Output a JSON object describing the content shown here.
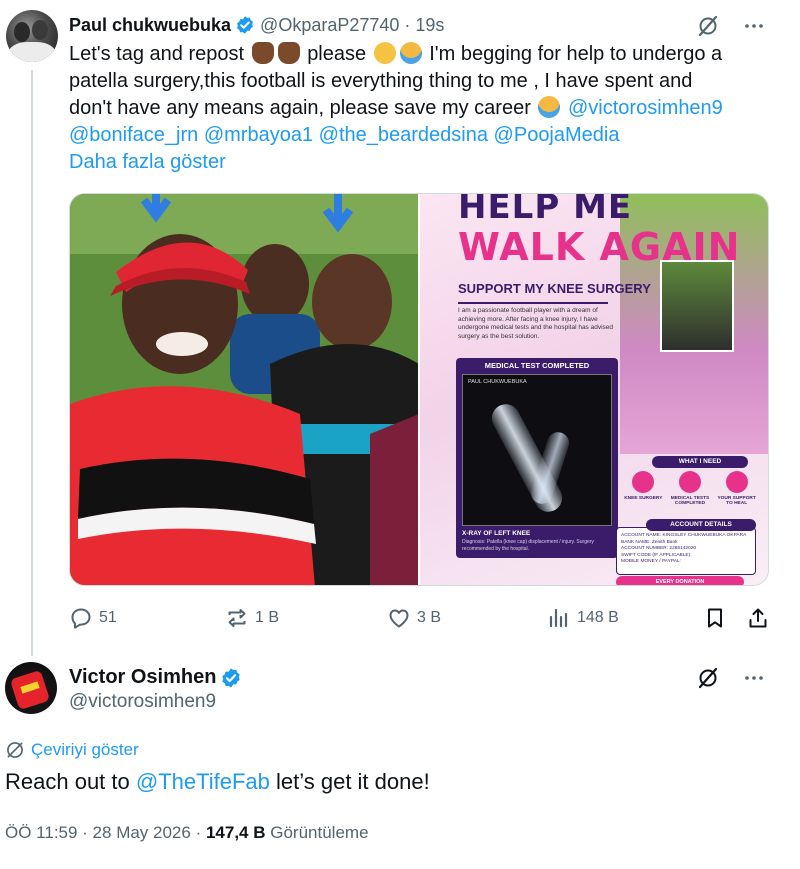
{
  "original_tweet": {
    "author_name": "Paul chukwuebuka",
    "handle": "@OkparaP27740",
    "separator": "·",
    "time": "19s",
    "text_line1": "Let's tag and repost",
    "text_please": "please",
    "text_line1_end": "I'm begging for help to undergo a",
    "text_line2": "patella surgery,this football is everything thing to me , I have spent and",
    "text_line3": "don't have any means again, please save my career",
    "mentions": [
      "@victorosimhen9",
      "@boniface_jrn",
      "@mrbayoa1",
      "@the_beardedsina",
      "@PoojaMedia"
    ],
    "show_more": "Daha fazla göster",
    "media": {
      "flyer_title_1": "HELP ME",
      "flyer_title_2": "WALK AGAIN",
      "flyer_subtitle": "SUPPORT MY KNEE SURGERY",
      "flyer_paragraph": "I am a passionate football player with a dream of achieving more. After facing a knee injury, I have undergone medical tests and the hospital has advised surgery as the best solution.",
      "medical_header": "MEDICAL TEST COMPLETED",
      "xray_name": "PAUL CHUKWUEBUKA",
      "xray_caption": "X-RAY OF LEFT KNEE",
      "xray_diagnosis": "Diagnosis: Patella (knee cap) displacement / injury. Surgery recommended by the hospital.",
      "need_label": "WHAT I NEED",
      "needs": [
        "KNEE SURGERY",
        "MEDICAL TESTS COMPLETED",
        "YOUR SUPPORT TO HEAL"
      ],
      "account_label": "ACCOUNT DETAILS",
      "account_name": "ACCOUNT NAME: KINGSLEY CHUKWUEBUKA OKPARA",
      "bank_name": "BANK NAME: Zenith Bank",
      "account_number": "ACCOUNT NUMBER: 2265142020",
      "swift": "SWIFT CODE (IF APPLICABLE):",
      "mobile_money": "MOBILE MONEY / PAYPAL:",
      "donation": "EVERY DONATION"
    },
    "stats": {
      "replies": "51",
      "reposts": "1 B",
      "likes": "3 B",
      "views": "148 B"
    }
  },
  "reply_tweet": {
    "author_name": "Victor Osimhen",
    "handle": "@victorosimhen9",
    "translate": "Çeviriyi göster",
    "text_before": "Reach out to",
    "mention": "@TheTifeFab",
    "text_after": "let’s get it done!",
    "timestamp": "ÖÖ 11:59 · 28 May 2026 ·",
    "views_count": "147,4 B",
    "views_label": "Görüntüleme"
  },
  "colors": {
    "link": "#1d9bf0",
    "text": "#0f1419",
    "muted": "#536471",
    "verified": "#1d9bf0"
  }
}
